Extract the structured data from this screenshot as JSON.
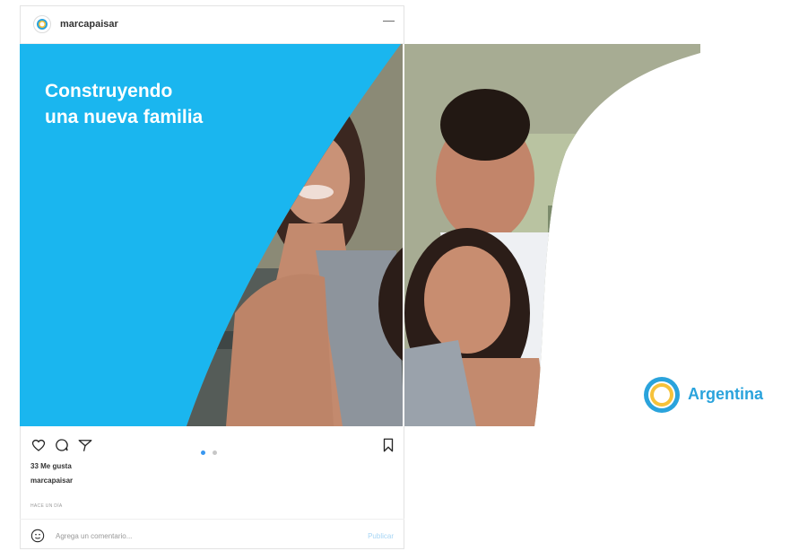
{
  "post": {
    "username": "marcapaisar",
    "more_label": "—",
    "headline_line1": "Construyendo",
    "headline_line2": "una nueva familia",
    "brand_name": "Argentina",
    "likes": "33 Me gusta",
    "caption_user": "marcapaisar",
    "time": "HACE UN DÍA",
    "comment_placeholder": "Agrega un comentario...",
    "post_button": "Publicar",
    "carousel": {
      "current": 1,
      "total": 2
    }
  },
  "colors": {
    "slide_blue": "#1ab6ef",
    "brand_blue": "#2aa3dc",
    "sun_yellow": "#f6c23a"
  },
  "icons": [
    "heart-icon",
    "comment-icon",
    "share-icon",
    "bookmark-icon",
    "emoji-icon",
    "sun-logo-icon"
  ]
}
